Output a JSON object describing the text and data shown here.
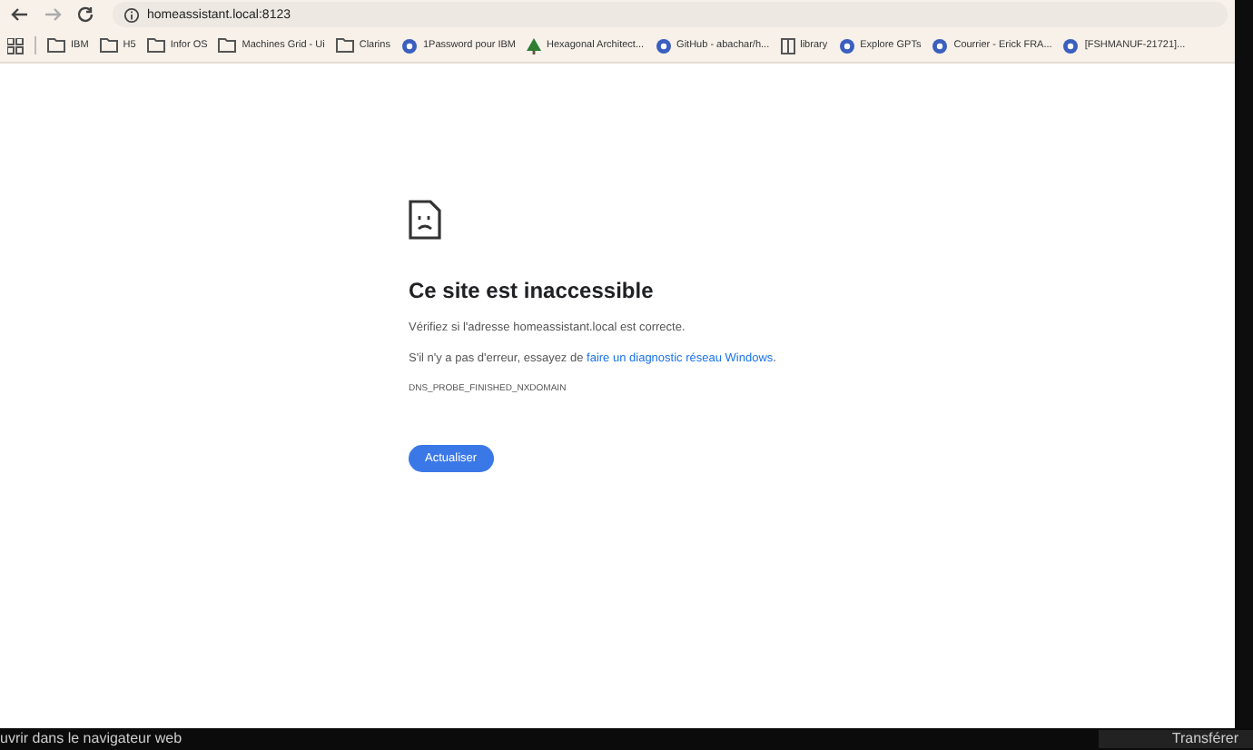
{
  "address_bar": {
    "url": "homeassistant.local:8123"
  },
  "bookmarks": [
    {
      "label": "IBM",
      "kind": "folder"
    },
    {
      "label": "H5",
      "kind": "folder"
    },
    {
      "label": "Infor OS",
      "kind": "folder"
    },
    {
      "label": "Machines Grid - Ui",
      "kind": "folder"
    },
    {
      "label": "Clarins",
      "kind": "folder"
    },
    {
      "label": "1Password pour IBM",
      "kind": "site"
    },
    {
      "label": "Hexagonal Architect...",
      "kind": "tree"
    },
    {
      "label": "GitHub - abachar/h...",
      "kind": "site"
    },
    {
      "label": "library",
      "kind": "book"
    },
    {
      "label": "Explore GPTs",
      "kind": "site"
    },
    {
      "label": "Courrier - Erick FRA...",
      "kind": "site"
    },
    {
      "label": "[FSHMANUF-21721]...",
      "kind": "site"
    }
  ],
  "error_page": {
    "title": "Ce site est inaccessible",
    "message": "Vérifiez si l'adresse homeassistant.local est correcte.",
    "suggestion": "S'il n'y a pas d'erreur, essayez de",
    "link": "faire un diagnostic réseau Windows",
    "suggestion_end": ".",
    "code": "DNS_PROBE_FINISHED_NXDOMAIN",
    "button": "Actualiser"
  },
  "bottom_bar": {
    "left": "uvrir dans le navigateur web",
    "right": "Transférer"
  }
}
